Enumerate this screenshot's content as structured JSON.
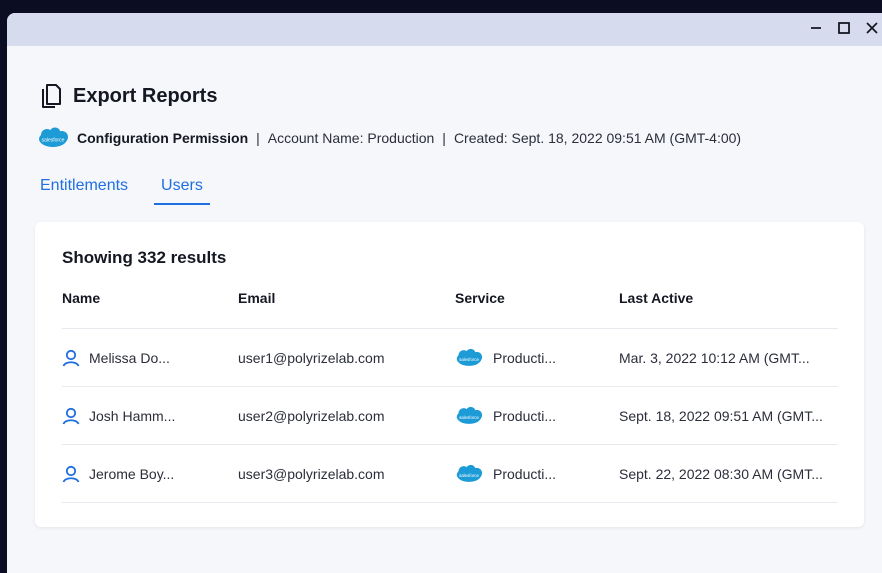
{
  "window": {
    "controls": {
      "minimize": "minimize-icon",
      "maximize": "maximize-icon",
      "close": "close-icon"
    }
  },
  "header": {
    "icon": "document-copy-icon",
    "title": "Export Reports"
  },
  "meta": {
    "logo_text": "salesforce",
    "permission": "Configuration Permission",
    "separator": "|",
    "account": "Account Name: Production",
    "created": "Created: Sept. 18, 2022 09:51 AM (GMT-4:00)"
  },
  "tabs": [
    {
      "label": "Entitlements",
      "active": false
    },
    {
      "label": "Users",
      "active": true
    }
  ],
  "results": {
    "summary": "Showing 332 results",
    "columns": [
      "Name",
      "Email",
      "Service",
      "Last Active"
    ],
    "rows": [
      {
        "name": "Melissa Do...",
        "email": "user1@polyrizelab.com",
        "service": "Producti...",
        "last_active": "Mar. 3, 2022 10:12 AM (GMT..."
      },
      {
        "name": "Josh Hamm...",
        "email": "user2@polyrizelab.com",
        "service": "Producti...",
        "last_active": "Sept. 18, 2022 09:51 AM (GMT..."
      },
      {
        "name": "Jerome Boy...",
        "email": "user3@polyrizelab.com",
        "service": "Producti...",
        "last_active": "Sept. 22, 2022 08:30 AM (GMT..."
      }
    ]
  },
  "colors": {
    "accent": "#1f6fe0",
    "salesforce": "#1d9bd7",
    "titlebar": "#d7dbee",
    "background": "#0b0d22"
  }
}
